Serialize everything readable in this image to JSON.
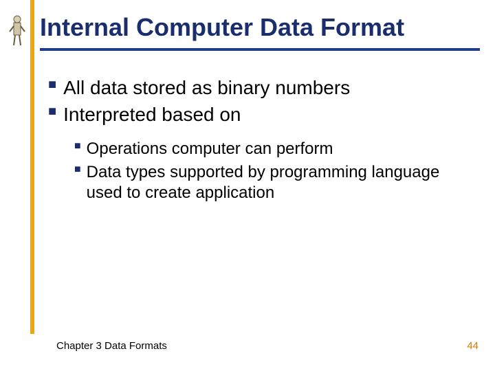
{
  "title": "Internal Computer Data Format",
  "bullets": {
    "level1": [
      "All data stored as binary numbers",
      "Interpreted based on"
    ],
    "level2": [
      "Operations computer can perform",
      "Data types supported by programming language used to create application"
    ]
  },
  "footer": {
    "left": "Chapter 3 Data Formats",
    "page": "44"
  },
  "bullet_char": "■"
}
